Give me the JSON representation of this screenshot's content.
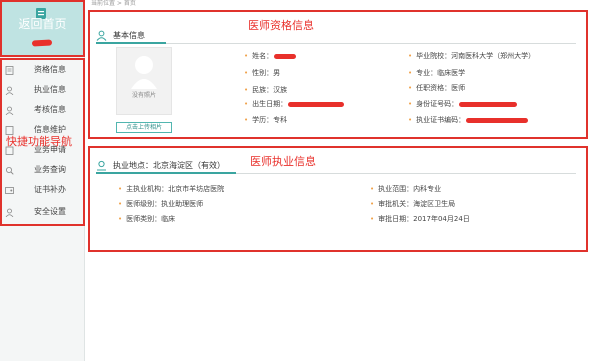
{
  "breadcrumb": {
    "label": "当前位置 > 首页"
  },
  "sidebar": {
    "home_label": "返回首页",
    "nav_annotation": "快捷功能导航",
    "items": [
      {
        "label": "资格信息"
      },
      {
        "label": "执业信息"
      },
      {
        "label": "考核信息"
      },
      {
        "label": "信息维护"
      },
      {
        "label": "业务申请"
      },
      {
        "label": "业务查询"
      },
      {
        "label": "证书补办"
      },
      {
        "label": "安全设置"
      }
    ]
  },
  "basic_info": {
    "title": "基本信息",
    "annotation": "医师资格信息",
    "photo_placeholder": "没有照片",
    "upload_button": "点击上传相片",
    "fields": {
      "name": "姓名：",
      "gender": "性别：男",
      "ethnicity": "民族：汉族",
      "birth_date": "出生日期：",
      "education": "学历：专科",
      "school": "毕业院校：河南医科大学（郑州大学）",
      "major": "专业：临床医学",
      "qualification": "任职资格：医师",
      "id_number": "身份证号码：",
      "cert_number": "执业证书编码："
    }
  },
  "practice_info": {
    "title": "执业地点：北京海淀区（有效）",
    "annotation": "医师执业信息",
    "fields": {
      "institution": "主执业机构：北京市羊坊店医院",
      "level": "医师级别：执业助理医师",
      "category": "医师类别：临床",
      "scope": "执业范围：内科专业",
      "authority": "审批机关：海淀区卫生局",
      "approval_date": "审批日期：2017年04月24日"
    }
  },
  "colors": {
    "accent": "#3aa5a0",
    "highlight": "#e0322c",
    "home_bg": "#bfe3e2"
  }
}
